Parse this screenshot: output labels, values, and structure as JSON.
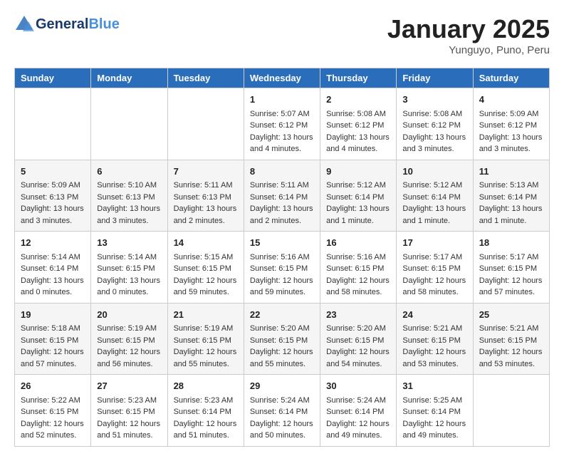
{
  "header": {
    "logo_line1": "General",
    "logo_line2": "Blue",
    "month": "January 2025",
    "location": "Yunguyo, Puno, Peru"
  },
  "weekdays": [
    "Sunday",
    "Monday",
    "Tuesday",
    "Wednesday",
    "Thursday",
    "Friday",
    "Saturday"
  ],
  "weeks": [
    [
      {
        "day": "",
        "sunrise": "",
        "sunset": "",
        "daylight": ""
      },
      {
        "day": "",
        "sunrise": "",
        "sunset": "",
        "daylight": ""
      },
      {
        "day": "",
        "sunrise": "",
        "sunset": "",
        "daylight": ""
      },
      {
        "day": "1",
        "sunrise": "Sunrise: 5:07 AM",
        "sunset": "Sunset: 6:12 PM",
        "daylight": "Daylight: 13 hours and 4 minutes."
      },
      {
        "day": "2",
        "sunrise": "Sunrise: 5:08 AM",
        "sunset": "Sunset: 6:12 PM",
        "daylight": "Daylight: 13 hours and 4 minutes."
      },
      {
        "day": "3",
        "sunrise": "Sunrise: 5:08 AM",
        "sunset": "Sunset: 6:12 PM",
        "daylight": "Daylight: 13 hours and 3 minutes."
      },
      {
        "day": "4",
        "sunrise": "Sunrise: 5:09 AM",
        "sunset": "Sunset: 6:12 PM",
        "daylight": "Daylight: 13 hours and 3 minutes."
      }
    ],
    [
      {
        "day": "5",
        "sunrise": "Sunrise: 5:09 AM",
        "sunset": "Sunset: 6:13 PM",
        "daylight": "Daylight: 13 hours and 3 minutes."
      },
      {
        "day": "6",
        "sunrise": "Sunrise: 5:10 AM",
        "sunset": "Sunset: 6:13 PM",
        "daylight": "Daylight: 13 hours and 3 minutes."
      },
      {
        "day": "7",
        "sunrise": "Sunrise: 5:11 AM",
        "sunset": "Sunset: 6:13 PM",
        "daylight": "Daylight: 13 hours and 2 minutes."
      },
      {
        "day": "8",
        "sunrise": "Sunrise: 5:11 AM",
        "sunset": "Sunset: 6:14 PM",
        "daylight": "Daylight: 13 hours and 2 minutes."
      },
      {
        "day": "9",
        "sunrise": "Sunrise: 5:12 AM",
        "sunset": "Sunset: 6:14 PM",
        "daylight": "Daylight: 13 hours and 1 minute."
      },
      {
        "day": "10",
        "sunrise": "Sunrise: 5:12 AM",
        "sunset": "Sunset: 6:14 PM",
        "daylight": "Daylight: 13 hours and 1 minute."
      },
      {
        "day": "11",
        "sunrise": "Sunrise: 5:13 AM",
        "sunset": "Sunset: 6:14 PM",
        "daylight": "Daylight: 13 hours and 1 minute."
      }
    ],
    [
      {
        "day": "12",
        "sunrise": "Sunrise: 5:14 AM",
        "sunset": "Sunset: 6:14 PM",
        "daylight": "Daylight: 13 hours and 0 minutes."
      },
      {
        "day": "13",
        "sunrise": "Sunrise: 5:14 AM",
        "sunset": "Sunset: 6:15 PM",
        "daylight": "Daylight: 13 hours and 0 minutes."
      },
      {
        "day": "14",
        "sunrise": "Sunrise: 5:15 AM",
        "sunset": "Sunset: 6:15 PM",
        "daylight": "Daylight: 12 hours and 59 minutes."
      },
      {
        "day": "15",
        "sunrise": "Sunrise: 5:16 AM",
        "sunset": "Sunset: 6:15 PM",
        "daylight": "Daylight: 12 hours and 59 minutes."
      },
      {
        "day": "16",
        "sunrise": "Sunrise: 5:16 AM",
        "sunset": "Sunset: 6:15 PM",
        "daylight": "Daylight: 12 hours and 58 minutes."
      },
      {
        "day": "17",
        "sunrise": "Sunrise: 5:17 AM",
        "sunset": "Sunset: 6:15 PM",
        "daylight": "Daylight: 12 hours and 58 minutes."
      },
      {
        "day": "18",
        "sunrise": "Sunrise: 5:17 AM",
        "sunset": "Sunset: 6:15 PM",
        "daylight": "Daylight: 12 hours and 57 minutes."
      }
    ],
    [
      {
        "day": "19",
        "sunrise": "Sunrise: 5:18 AM",
        "sunset": "Sunset: 6:15 PM",
        "daylight": "Daylight: 12 hours and 57 minutes."
      },
      {
        "day": "20",
        "sunrise": "Sunrise: 5:19 AM",
        "sunset": "Sunset: 6:15 PM",
        "daylight": "Daylight: 12 hours and 56 minutes."
      },
      {
        "day": "21",
        "sunrise": "Sunrise: 5:19 AM",
        "sunset": "Sunset: 6:15 PM",
        "daylight": "Daylight: 12 hours and 55 minutes."
      },
      {
        "day": "22",
        "sunrise": "Sunrise: 5:20 AM",
        "sunset": "Sunset: 6:15 PM",
        "daylight": "Daylight: 12 hours and 55 minutes."
      },
      {
        "day": "23",
        "sunrise": "Sunrise: 5:20 AM",
        "sunset": "Sunset: 6:15 PM",
        "daylight": "Daylight: 12 hours and 54 minutes."
      },
      {
        "day": "24",
        "sunrise": "Sunrise: 5:21 AM",
        "sunset": "Sunset: 6:15 PM",
        "daylight": "Daylight: 12 hours and 53 minutes."
      },
      {
        "day": "25",
        "sunrise": "Sunrise: 5:21 AM",
        "sunset": "Sunset: 6:15 PM",
        "daylight": "Daylight: 12 hours and 53 minutes."
      }
    ],
    [
      {
        "day": "26",
        "sunrise": "Sunrise: 5:22 AM",
        "sunset": "Sunset: 6:15 PM",
        "daylight": "Daylight: 12 hours and 52 minutes."
      },
      {
        "day": "27",
        "sunrise": "Sunrise: 5:23 AM",
        "sunset": "Sunset: 6:15 PM",
        "daylight": "Daylight: 12 hours and 51 minutes."
      },
      {
        "day": "28",
        "sunrise": "Sunrise: 5:23 AM",
        "sunset": "Sunset: 6:14 PM",
        "daylight": "Daylight: 12 hours and 51 minutes."
      },
      {
        "day": "29",
        "sunrise": "Sunrise: 5:24 AM",
        "sunset": "Sunset: 6:14 PM",
        "daylight": "Daylight: 12 hours and 50 minutes."
      },
      {
        "day": "30",
        "sunrise": "Sunrise: 5:24 AM",
        "sunset": "Sunset: 6:14 PM",
        "daylight": "Daylight: 12 hours and 49 minutes."
      },
      {
        "day": "31",
        "sunrise": "Sunrise: 5:25 AM",
        "sunset": "Sunset: 6:14 PM",
        "daylight": "Daylight: 12 hours and 49 minutes."
      },
      {
        "day": "",
        "sunrise": "",
        "sunset": "",
        "daylight": ""
      }
    ]
  ]
}
